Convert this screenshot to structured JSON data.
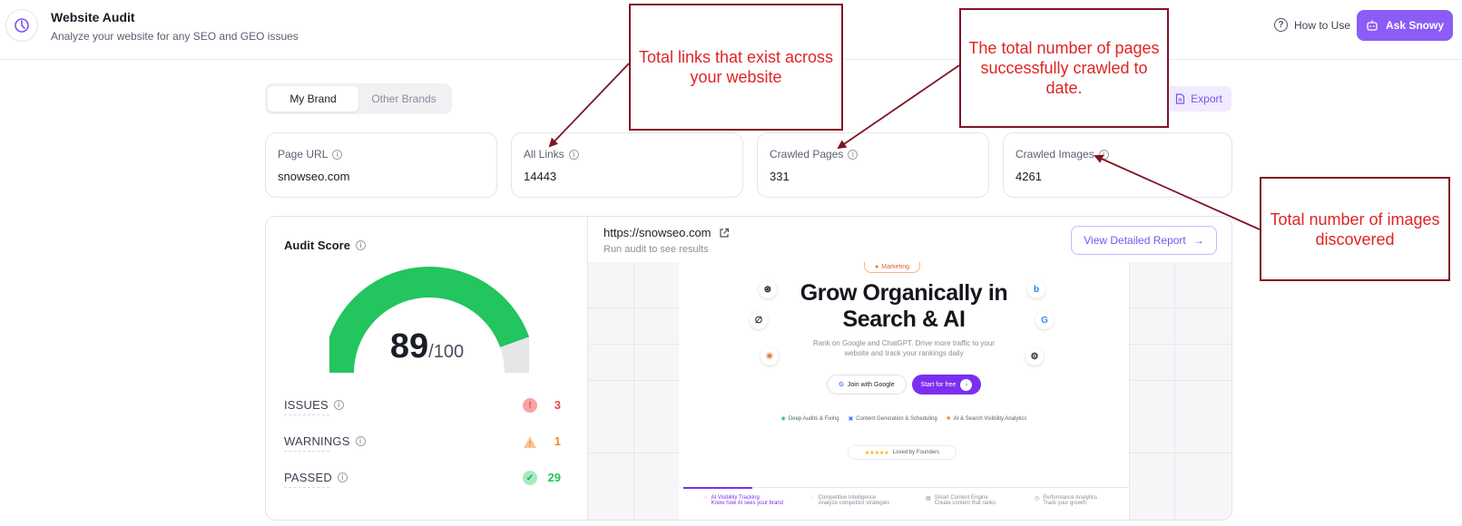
{
  "header": {
    "title": "Website Audit",
    "subtitle": "Analyze your website for any SEO and GEO issues",
    "how_to_use": "How to Use",
    "ask_button": "Ask Snowy"
  },
  "toggle": {
    "active": "My Brand",
    "inactive": "Other Brands"
  },
  "export_label": "Export",
  "cards": [
    {
      "label": "Page URL",
      "value": "snowseo.com"
    },
    {
      "label": "All Links",
      "value": "14443"
    },
    {
      "label": "Crawled Pages",
      "value": "331"
    },
    {
      "label": "Crawled Images",
      "value": "4261"
    }
  ],
  "audit": {
    "title": "Audit Score",
    "score": "89",
    "score_max": "/100",
    "score_fraction": 0.89,
    "rows": [
      {
        "label": "ISSUES",
        "count": "3",
        "color": "#e5484d"
      },
      {
        "label": "WARNINGS",
        "count": "1",
        "color": "#f08a24"
      },
      {
        "label": "PASSED",
        "count": "29",
        "color": "#22c55e"
      }
    ]
  },
  "preview": {
    "url": "https://snowseo.com",
    "run_text": "Run audit to see results",
    "report_button": "View Detailed Report",
    "badge": "Marketing",
    "hero_line1": "Grow Organically in",
    "hero_line2": "Search & AI",
    "hero_sub": "Rank on Google and ChatGPT. Drive more traffic to your website and track your rankings daily",
    "btn_google": "Join with Google",
    "btn_free": "Start for free",
    "features": [
      "Deep Audits & Fixing",
      "Content Generation & Scheduling",
      "AI & Search Visibility Analytics"
    ],
    "loved": "Loved by Founders",
    "tabs": [
      {
        "title": "AI Visibility Tracking",
        "sub": "Know how AI sees your brand"
      },
      {
        "title": "Competitive Intelligence",
        "sub": "Analyze competitor strategies"
      },
      {
        "title": "Smart Content Engine",
        "sub": "Create content that ranks"
      },
      {
        "title": "Performance Analytics",
        "sub": "Track your growth"
      }
    ]
  },
  "annotations": {
    "links": "Total links that exist across your website",
    "pages": "The total number of pages successfully crawled to date.",
    "images": "Total number of images discovered"
  },
  "colors": {
    "accent": "#8b5cf6",
    "gauge": "#22c55e",
    "annotation_border": "#7f1425",
    "annotation_text": "#e02424"
  }
}
